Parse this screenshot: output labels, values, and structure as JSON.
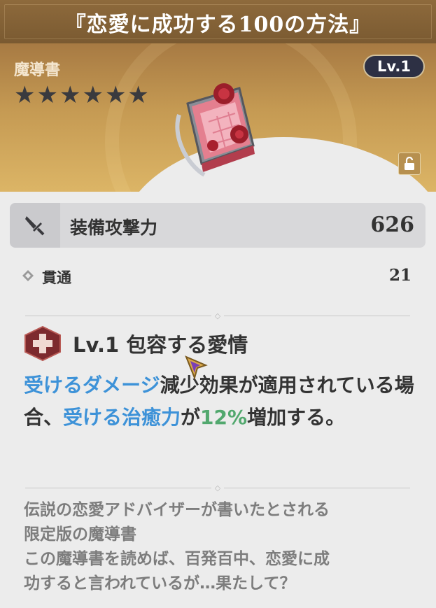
{
  "weapon": {
    "title": "『恋愛に成功する100の方法』",
    "type": "魔導書",
    "rarity": 6,
    "level_badge": "Lv.1",
    "icons": {
      "rarity": "star-icon",
      "lock": "lock-open-icon",
      "main_stat": "sword-icon",
      "sub_stat": "diamond-icon",
      "skill": "heal-cross-icon",
      "artwork": "rose-book-icon"
    }
  },
  "main_stat": {
    "name": "装備攻撃力",
    "value": "626"
  },
  "sub_stat": {
    "name": "貫通",
    "value": "21"
  },
  "skill": {
    "title": "Lv.1 包容する愛情",
    "desc": {
      "part1": "受けるダメージ",
      "part2": "減少効果が適用されている場合、",
      "part3": "受ける治癒力",
      "part4": "が",
      "part5": "12%",
      "part6": "増加する。"
    }
  },
  "lore": {
    "line1": "伝説の恋愛アドバイザーが書いたとされる",
    "line2": "限定版の魔導書",
    "line3": "この魔導書を読めば、百発百中、恋愛に成",
    "line4": "功すると言われているが…果たして？"
  },
  "colors": {
    "title_bg": "#7a5a31",
    "banner": "#c59a53",
    "highlight_blue": "#3d92d8",
    "highlight_green": "#52a86e",
    "lv_badge_bg": "#2d3044",
    "skill_icon_red": "#7d2a2e"
  }
}
